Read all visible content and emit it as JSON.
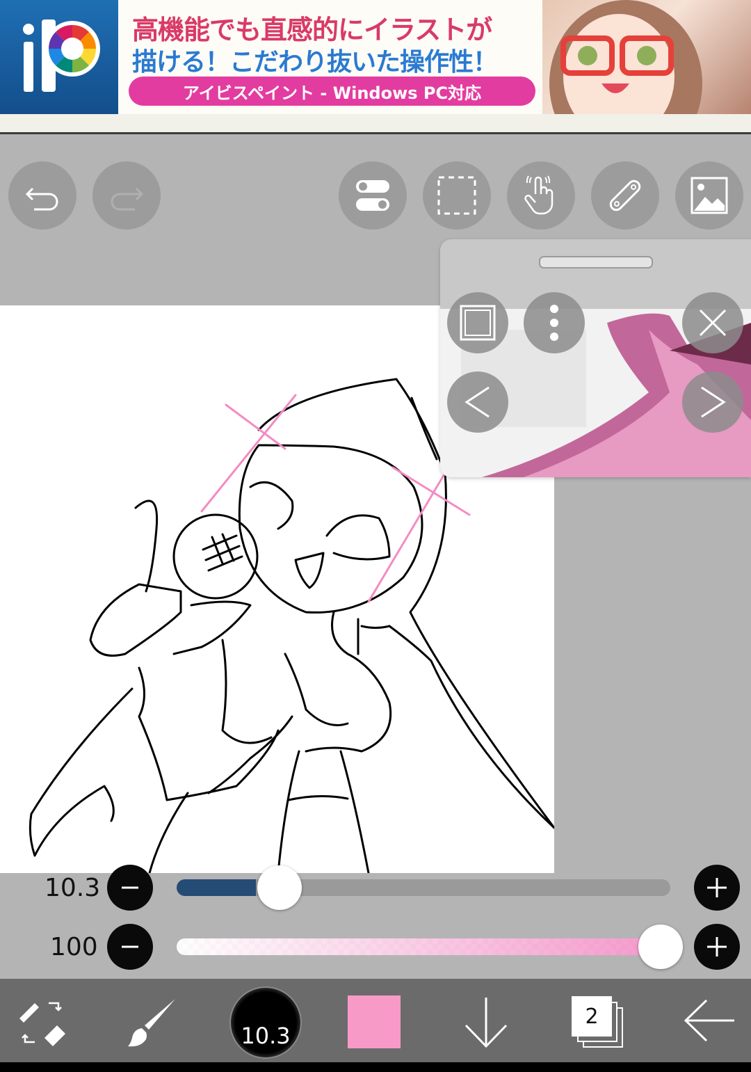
{
  "ad": {
    "logo_text": "iP",
    "headline_line1": "高機能でも直感的にイラストが",
    "headline_line2": "描ける！こだわり抜いた操作性！",
    "pill_text": "アイビスペイント - Windows PC対応"
  },
  "toolbar": {
    "undo": "undo-icon",
    "redo": "redo-icon",
    "toggle": "toggle-icon",
    "selection": "selection-icon",
    "gesture": "hand-touch-icon",
    "ruler": "ruler-icon",
    "image": "image-icon"
  },
  "reference_panel": {
    "buttons": [
      "square-frame-icon",
      "more-vertical-icon",
      "close-icon",
      "chevron-left-icon",
      "chevron-right-icon"
    ]
  },
  "sliders": {
    "brush_size": {
      "value": "10.3",
      "fraction": 0.16
    },
    "opacity": {
      "value": "100",
      "fraction": 1.0
    }
  },
  "bottom_toolbar": {
    "brush_size_label": "10.3",
    "color": "#f89ac8",
    "layer_count": "2"
  },
  "colors": {
    "background": "#b4b4b4",
    "bottom_bar": "#6b6b6b",
    "slider_fill": "#244c74",
    "stroke_pink": "#f48bc4"
  }
}
